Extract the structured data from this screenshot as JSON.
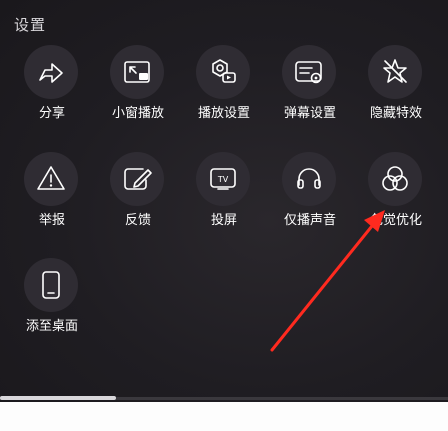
{
  "panel": {
    "title": "设置"
  },
  "row1": [
    {
      "label": "分享",
      "icon": "share-icon"
    },
    {
      "label": "小窗播放",
      "icon": "picture-in-picture-icon"
    },
    {
      "label": "播放设置",
      "icon": "playback-settings-icon"
    },
    {
      "label": "弹幕设置",
      "icon": "danmaku-settings-icon"
    },
    {
      "label": "隐藏特效",
      "icon": "hide-effects-icon"
    }
  ],
  "row2": [
    {
      "label": "举报",
      "icon": "report-warning-icon"
    },
    {
      "label": "反馈",
      "icon": "feedback-edit-icon"
    },
    {
      "label": "投屏",
      "icon": "tv-cast-icon"
    },
    {
      "label": "仅播声音",
      "icon": "headphones-icon"
    },
    {
      "label": "色觉优化",
      "icon": "color-circles-icon"
    }
  ],
  "row3": [
    {
      "label": "添至桌面",
      "icon": "phone-add-desktop-icon"
    }
  ],
  "colors": {
    "background": "#1d1b20",
    "circle": "#2f2c33",
    "arrow": "#ff2a1f"
  },
  "playback": {
    "progress": 0.26
  }
}
